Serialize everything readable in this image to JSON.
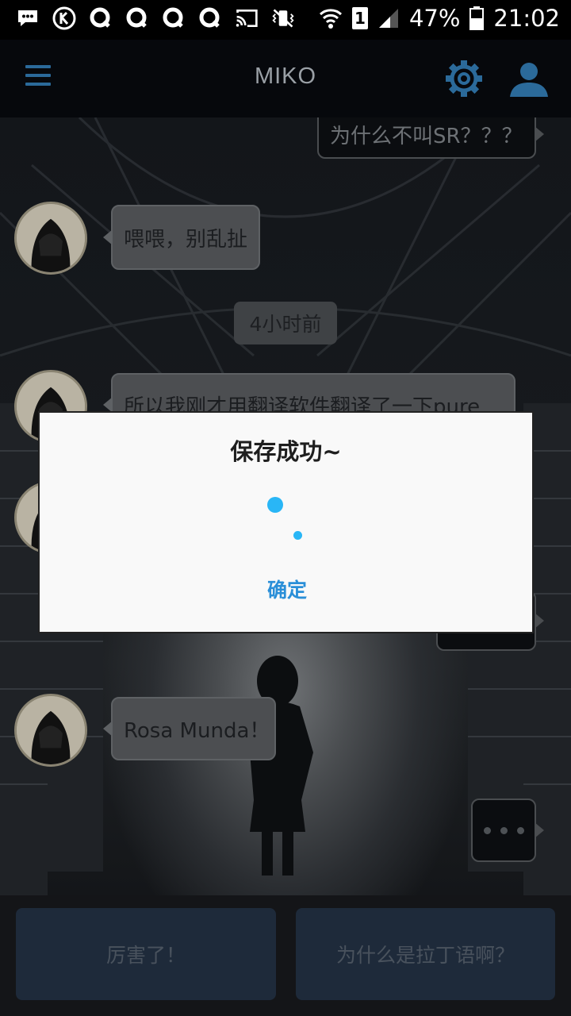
{
  "status_bar": {
    "battery_percent": "47%",
    "time": "21:02",
    "sim_slot": "1",
    "notification_icons": [
      "chat-bubble-icon",
      "k-circle-icon",
      "q-icon",
      "q-icon",
      "q-icon",
      "q-icon",
      "cast-icon",
      "vibrate-icon",
      "wifi-icon"
    ]
  },
  "app_bar": {
    "title": "MIKO"
  },
  "chat": {
    "messages": [
      {
        "side": "right",
        "text": "为什么不叫SR？？？"
      },
      {
        "side": "left",
        "text": "喂喂，别乱扯"
      },
      {
        "side": "left",
        "text": "所以我刚才用翻译软件翻译了一下pure"
      },
      {
        "side": "left",
        "text": "Rosa Munda！"
      }
    ],
    "timestamp": "4小时前",
    "typing_indicator": "•••"
  },
  "dialog": {
    "title": "保存成功~",
    "confirm_label": "确定"
  },
  "replies": {
    "option_1": "厉害了！",
    "option_2": "为什么是拉丁语啊？"
  },
  "colors": {
    "accent": "#2a8fd8",
    "spinner": "#29b6f6",
    "icon_blue": "#2b6a9a",
    "reply_button": "#1e2a3a"
  }
}
